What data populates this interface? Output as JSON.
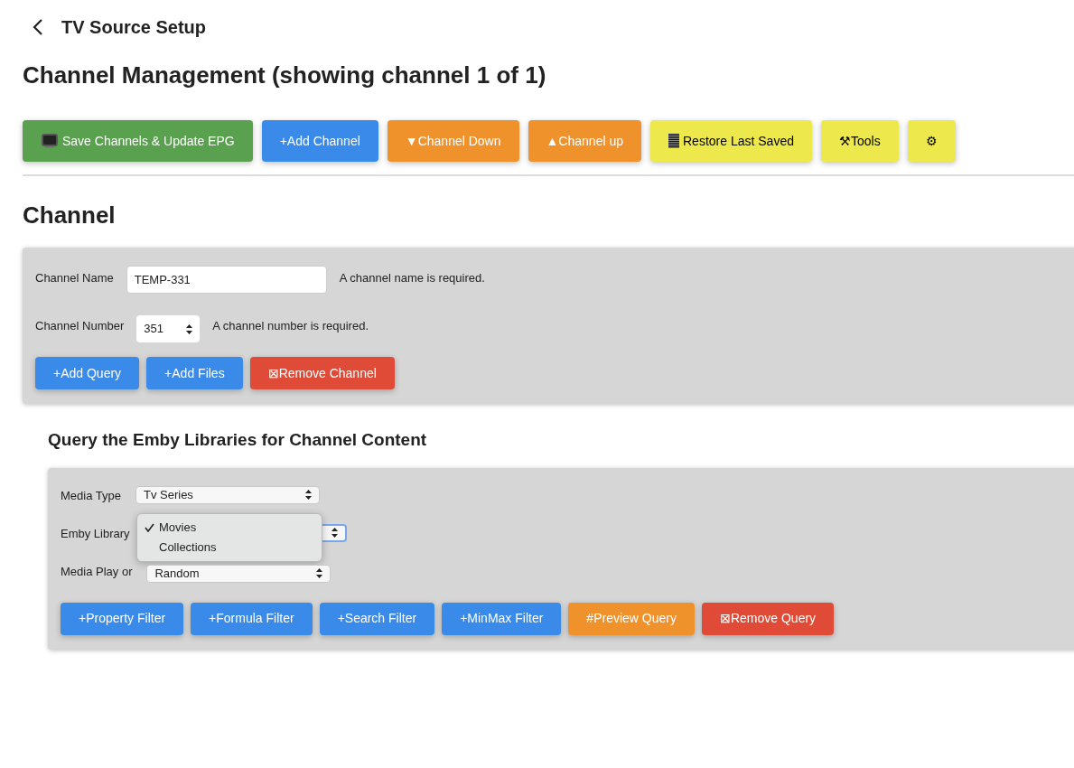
{
  "header": {
    "title": "TV Source Setup"
  },
  "heading": "Channel Management (showing channel 1 of 1)",
  "toolbar": [
    {
      "label": "Save Channels & Update EPG",
      "kind": "tv",
      "color": "#5aa14f"
    },
    {
      "label": "+Add Channel",
      "kind": "text",
      "color": "#3a8be9"
    },
    {
      "label": "▼Channel Down",
      "kind": "text",
      "color": "#f0922c"
    },
    {
      "label": "▲Channel up",
      "kind": "text",
      "color": "#f0922c"
    },
    {
      "label": "Restore Last Saved",
      "kind": "bars",
      "color": "#ede84c"
    },
    {
      "label": "⚒Tools",
      "kind": "text",
      "color": "#ede84c"
    },
    {
      "label": "⚙",
      "kind": "text",
      "color": "#ede84c"
    }
  ],
  "channel": {
    "title": "Channel",
    "fields": [
      {
        "label": "Channel Name",
        "value": "TEMP-331",
        "kind": "text",
        "hint": "A channel name is required."
      },
      {
        "label": "Channel Number",
        "value": "351",
        "kind": "number",
        "hint": "A channel number is required."
      }
    ],
    "buttons": [
      {
        "label": "+Add Query",
        "color": "#3a8be9"
      },
      {
        "label": "+Add Files",
        "color": "#3a8be9"
      },
      {
        "label": "⊠Remove Channel",
        "color": "#df4b36"
      }
    ]
  },
  "query": {
    "title": "Query the Emby Libraries for Channel Content",
    "fields": [
      {
        "label": "Media Type",
        "value": "Tv Series",
        "open": false
      },
      {
        "label": "Emby Library",
        "open": true,
        "options": [
          {
            "label": "Movies",
            "selected": true
          },
          {
            "label": "Collections",
            "selected": false
          }
        ]
      },
      {
        "label": "Media Play or",
        "value": "Random",
        "open": false
      }
    ],
    "buttons": [
      {
        "label": "+Property Filter",
        "color": "#3a8be9"
      },
      {
        "label": "+Formula Filter",
        "color": "#3a8be9"
      },
      {
        "label": "+Search Filter",
        "color": "#3a8be9"
      },
      {
        "label": "+MinMax Filter",
        "color": "#3a8be9"
      },
      {
        "label": "#Preview Query",
        "color": "#f0922c"
      },
      {
        "label": "⊠Remove Query",
        "color": "#df4b36"
      }
    ]
  }
}
